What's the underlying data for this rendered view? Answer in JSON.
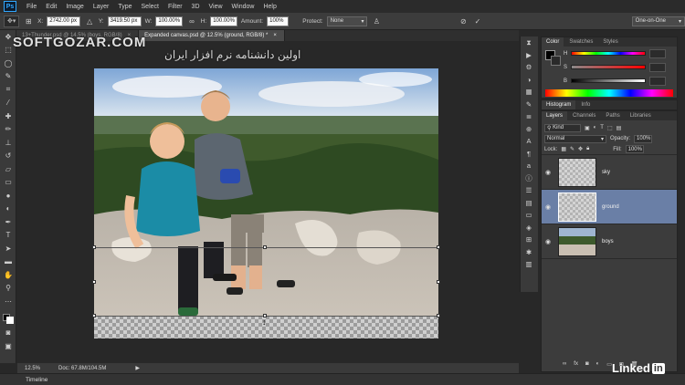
{
  "app": {
    "logo": "Ps"
  },
  "menu": [
    "File",
    "Edit",
    "Image",
    "Layer",
    "Type",
    "Select",
    "Filter",
    "3D",
    "View",
    "Window",
    "Help"
  ],
  "options": {
    "x_label": "X:",
    "x_value": "2742.00 px",
    "y_label": "Y:",
    "y_value": "3419.50 px",
    "w_label": "W:",
    "w_value": "100.00%",
    "h_label": "H:",
    "h_value": "100.00%",
    "amount_label": "Amount:",
    "amount_value": "100%",
    "protect_label": "Protect:",
    "protect_value": "None",
    "workspace": "One-on-One",
    "cancel_icon": "cancel-icon",
    "commit_icon": "commit-check-icon"
  },
  "tabs": [
    {
      "label": "13+Thunder.psd @ 14.5% (boys, RGB/8)",
      "active": false
    },
    {
      "label": "Expanded canvas.psd @ 12.5% (ground, RGB/8) *",
      "active": true
    }
  ],
  "status": {
    "zoom": "12.5%",
    "doc": "Doc: 67.8M/104.5M"
  },
  "timeline": "Timeline",
  "color_panel": {
    "tabs": [
      "Color",
      "Swatches",
      "Styles"
    ],
    "sliders": [
      {
        "label": "H",
        "value": "0"
      },
      {
        "label": "S",
        "value": "0"
      },
      {
        "label": "B",
        "value": "0"
      }
    ]
  },
  "histogram_tabs": [
    "Histogram",
    "Info"
  ],
  "layers_panel": {
    "tabs": [
      "Layers",
      "Channels",
      "Paths",
      "Libraries"
    ],
    "filter": "Kind",
    "blend_mode": "Normal",
    "opacity_label": "Opacity:",
    "opacity": "100%",
    "lock_label": "Lock:",
    "fill_label": "Fill:",
    "fill": "100%",
    "layers": [
      {
        "name": "sky",
        "selected": false
      },
      {
        "name": "ground",
        "selected": true
      },
      {
        "name": "boys",
        "selected": false
      }
    ]
  },
  "watermark": "SOFTGOZAR.COM",
  "watermark_ar": "اولین دانشنامه نرم افزار ایران",
  "brand": {
    "name": "Linked",
    "in": "in"
  }
}
